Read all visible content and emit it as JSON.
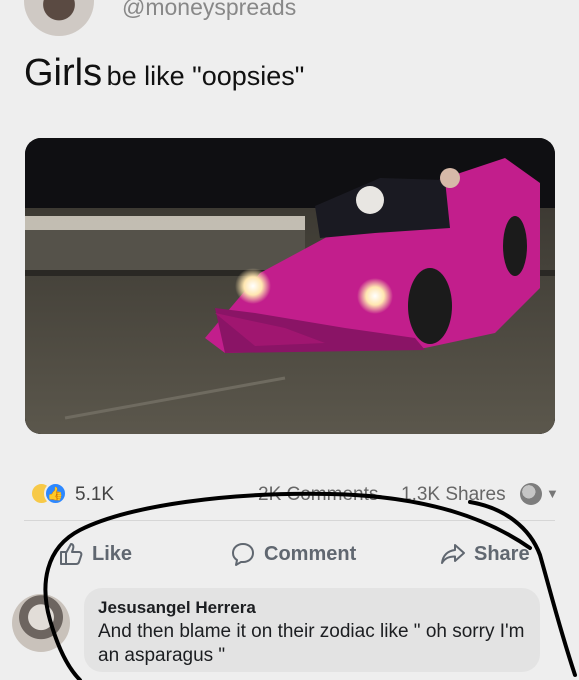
{
  "post": {
    "author_handle": "@moneyspreads",
    "caption_lead": "Girls",
    "caption_rest": "be like \"oopsies\""
  },
  "stats": {
    "reaction_count": "5.1K",
    "comments": "2K Comments",
    "shares": "1.3K Shares"
  },
  "actions": {
    "like": "Like",
    "comment": "Comment",
    "share": "Share"
  },
  "comment": {
    "author": "Jesusangel Herrera",
    "text": "And then blame it on their zodiac like \" oh sorry I'm an asparagus \""
  },
  "colors": {
    "car": "#c21e8c",
    "like_blue": "#2d88ff",
    "haha_yellow": "#f7c948",
    "marker": "#000000"
  },
  "icons": [
    "haha-reaction-icon",
    "like-reaction-icon",
    "thumbs-up-icon",
    "comment-icon",
    "share-icon",
    "audience-globe-icon"
  ]
}
